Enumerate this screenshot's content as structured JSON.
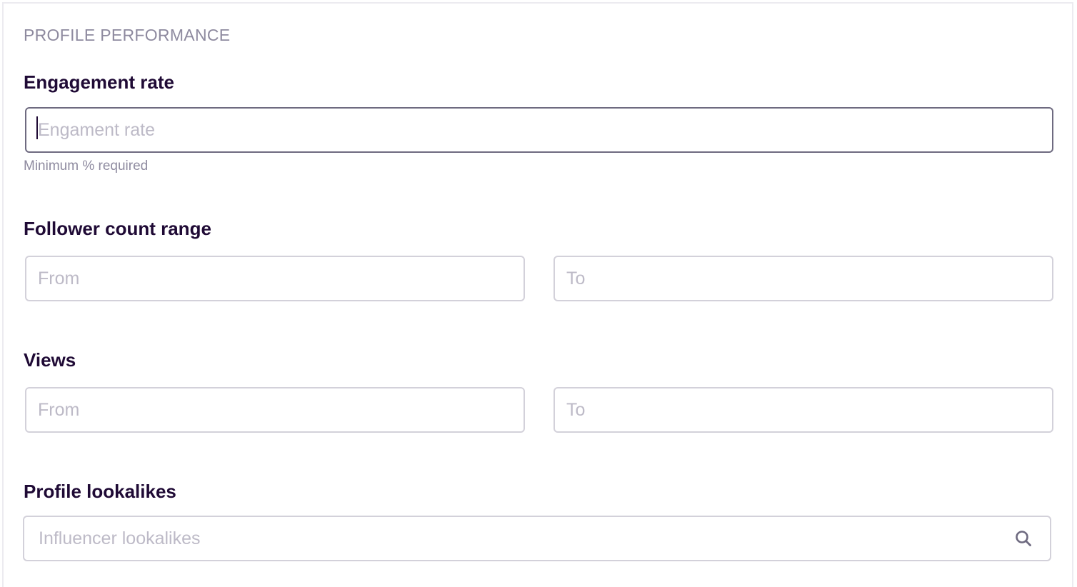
{
  "section": {
    "title": "PROFILE PERFORMANCE"
  },
  "engagement": {
    "label": "Engagement rate",
    "placeholder": "Engament rate",
    "value": "",
    "helper": "Minimum % required"
  },
  "followers": {
    "label": "Follower count range",
    "from_placeholder": "From",
    "to_placeholder": "To"
  },
  "views": {
    "label": "Views",
    "from_placeholder": "From",
    "to_placeholder": "To"
  },
  "lookalikes": {
    "label": "Profile lookalikes",
    "placeholder": "Influencer lookalikes",
    "icon": "search-icon"
  },
  "colors": {
    "heading": "#1f0a35",
    "muted": "#8e8a9f",
    "placeholder": "#bdbac7",
    "border": "#d3d1da",
    "border_focused": "#6e6a80"
  }
}
